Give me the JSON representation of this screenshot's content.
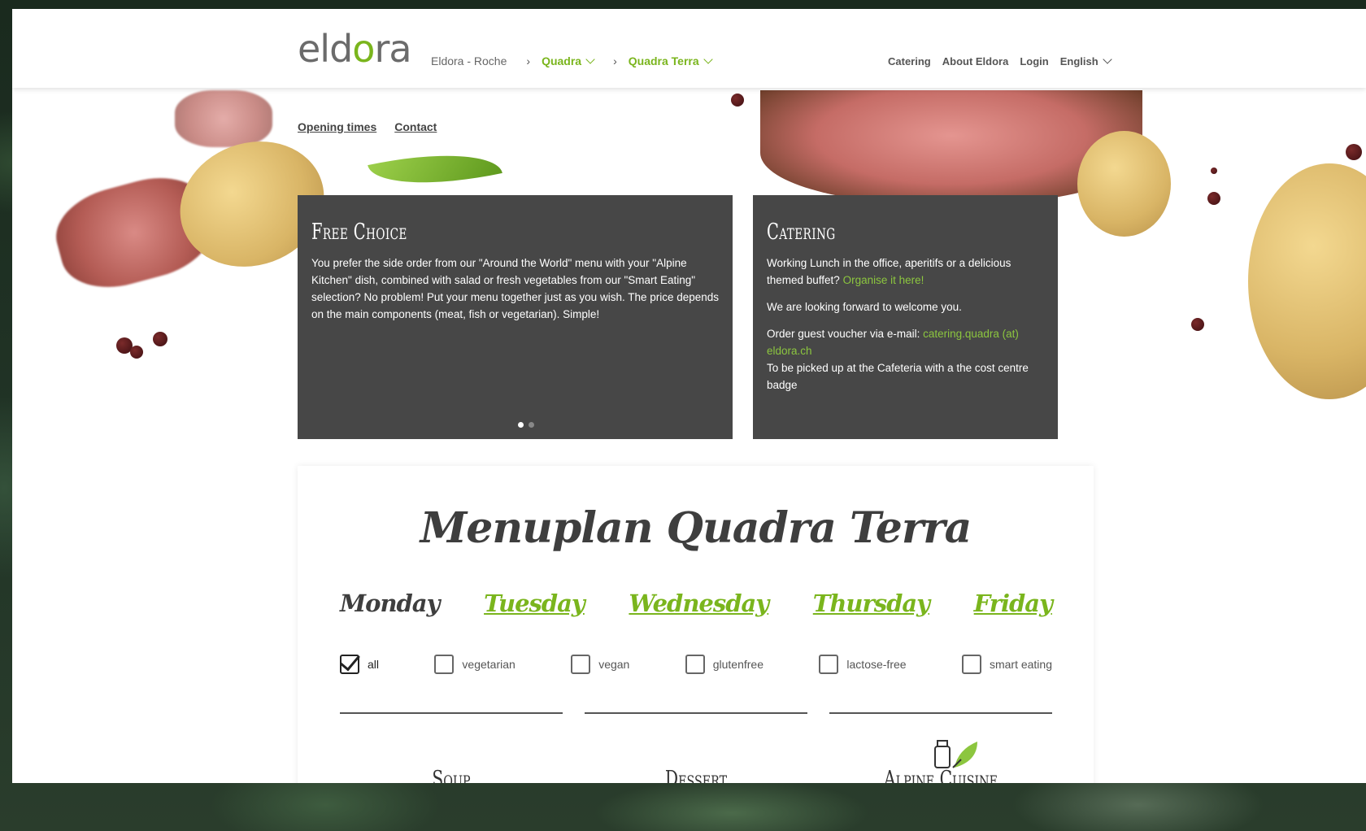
{
  "header": {
    "logo": {
      "part1": "eld",
      "part2": "o",
      "part3": "ra"
    },
    "breadcrumb": {
      "home": "Eldora - Roche",
      "level1": "Quadra",
      "level2": "Quadra Terra"
    },
    "nav": {
      "catering": "Catering",
      "about": "About Eldora",
      "login": "Login",
      "language": "English"
    }
  },
  "subnav": {
    "opening_times": "Opening times",
    "contact": "Contact"
  },
  "free_choice": {
    "title": "Free Choice",
    "text": "You prefer the side order from our \"Around the World\" menu with your \"Alpine Kitchen\" dish, combined with salad or fresh vegetables from our \"Smart Eating\" selection? No problem! Put your menu together just as you wish. The price depends on the main components (meat, fish or vegetarian). Simple!"
  },
  "catering": {
    "title": "Catering",
    "text1": "Working Lunch in the office, aperitifs or a delicious themed buffet?",
    "link1": "Organise it here!",
    "text2": "We are looking forward to welcome you.",
    "text3": "Order guest voucher via e-mail:",
    "email": "catering.quadra (at) eldora.ch",
    "text4": "To be picked up at the Cafeteria with a the cost centre badge"
  },
  "menu": {
    "title": "Menuplan Quadra Terra",
    "days": [
      "Monday",
      "Tuesday",
      "Wednesday",
      "Thursday",
      "Friday"
    ],
    "active_day": "Monday",
    "filters": [
      {
        "label": "all",
        "checked": true
      },
      {
        "label": "vegetarian",
        "checked": false
      },
      {
        "label": "vegan",
        "checked": false
      },
      {
        "label": "glutenfree",
        "checked": false
      },
      {
        "label": "lactose-free",
        "checked": false
      },
      {
        "label": "smart eating",
        "checked": false
      }
    ],
    "categories": [
      "Soup",
      "Dessert",
      "Alpine Cuisine"
    ]
  },
  "colors": {
    "brand_green": "#7ab51d",
    "card_bg": "#474747",
    "text_dark": "#3e3e3e"
  }
}
